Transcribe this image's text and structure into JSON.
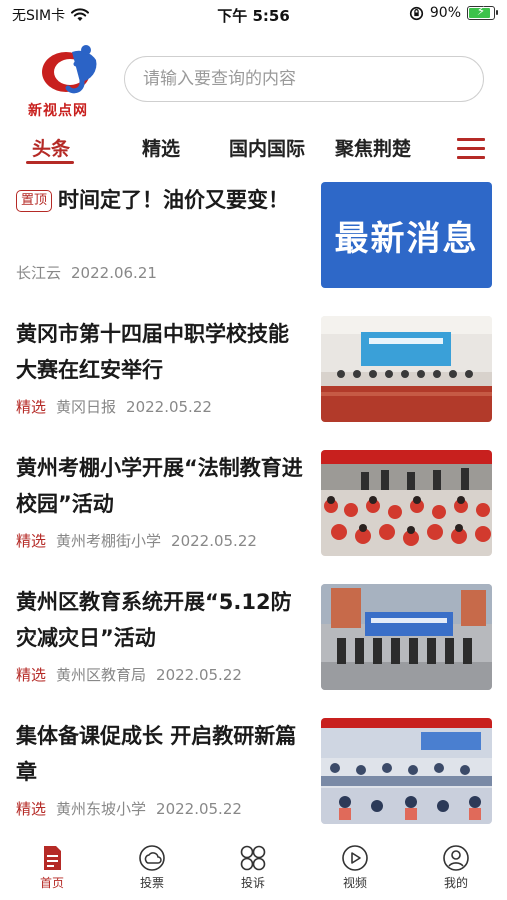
{
  "status_bar": {
    "carrier": "无SIM卡",
    "time": "下午 5:56",
    "battery": "90%",
    "battery_level": 0.9
  },
  "header": {
    "logo_text": "新视点网",
    "search_placeholder": "请输入要查询的内容"
  },
  "tabs": [
    {
      "label": "头条",
      "active": true
    },
    {
      "label": "精选",
      "active": false
    },
    {
      "label": "国内国际",
      "active": false
    },
    {
      "label": "聚焦荆楚",
      "active": false
    }
  ],
  "news": [
    {
      "pin": "置顶",
      "title": "时间定了！油价又要变！",
      "tag": "",
      "source": "长江云",
      "date": "2022.06.21",
      "thumb_text": "最新消息"
    },
    {
      "title": "黄冈市第十四届中职学校技能大赛在红安举行",
      "tag": "精选",
      "source": "黄冈日报",
      "date": "2022.05.22"
    },
    {
      "title": "黄州考棚小学开展“法制教育进校园”活动",
      "tag": "精选",
      "source": "黄州考棚街小学",
      "date": "2022.05.22"
    },
    {
      "title": "黄州区教育系统开展“5.12防灾减灾日”活动",
      "tag": "精选",
      "source": "黄州区教育局",
      "date": "2022.05.22"
    },
    {
      "title": "集体备课促成长 开启教研新篇章",
      "tag": "精选",
      "source": "黄州东坡小学",
      "date": "2022.05.22"
    }
  ],
  "tabbar": [
    {
      "label": "首页",
      "icon": "home-icon",
      "active": true
    },
    {
      "label": "投票",
      "icon": "vote-icon",
      "active": false
    },
    {
      "label": "投诉",
      "icon": "complaint-icon",
      "active": false
    },
    {
      "label": "视频",
      "icon": "video-icon",
      "active": false
    },
    {
      "label": "我的",
      "icon": "profile-icon",
      "active": false
    }
  ],
  "colors": {
    "accent": "#b52a26",
    "thumb_blue": "#2e68c8",
    "battery_green": "#3cc24a"
  }
}
